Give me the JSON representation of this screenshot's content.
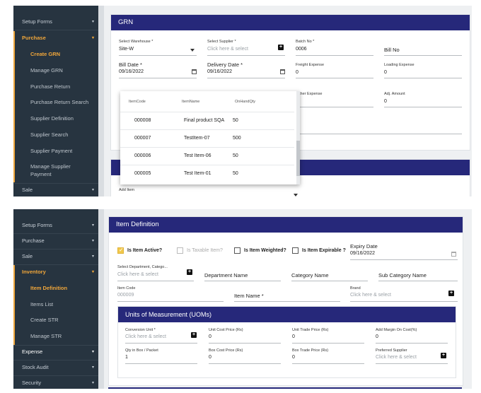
{
  "shot1": {
    "sidebar": {
      "setup_forms": "Setup Forms",
      "purchase": "Purchase",
      "items": [
        "Create GRN",
        "Manage GRN",
        "Purchase Return",
        "Purchase Return Search",
        "Supplier Definition",
        "Supplier Search",
        "Supplier Payment",
        "Manage Supplier Payment"
      ],
      "sale": "Sale"
    },
    "grn": {
      "title": "GRN",
      "warehouse_label": "Select Warehouse *",
      "warehouse_value": "Site-W",
      "supplier_label": "Select Supplier *",
      "supplier_placeholder": "Click here & select",
      "batch_label": "Batch No *",
      "batch_value": "0006",
      "bill_no_label": "Bill No",
      "bill_date_label": "Bill Date *",
      "bill_date_value": "09/16/2022",
      "delivery_date_label": "Delivery Date *",
      "delivery_date_value": "09/16/2022",
      "freight_label": "Freight Expense",
      "freight_value": "0",
      "loading_label": "Loading Expense",
      "loading_value": "0",
      "other_label": "ther Expense",
      "adj_label": "Adj. Amount",
      "adj_value": "0",
      "add_item_label": "Add Item"
    },
    "dropdown": {
      "headers": [
        "ItemCode",
        "ItemName",
        "OnHandQty"
      ],
      "rows": [
        {
          "code": "000008",
          "name": "Final product SQA",
          "qty": "50"
        },
        {
          "code": "000007",
          "name": "TestItem-07",
          "qty": "500"
        },
        {
          "code": "000006",
          "name": "Test Item-06",
          "qty": "50"
        },
        {
          "code": "000005",
          "name": "Test Item-01",
          "qty": "50"
        }
      ]
    }
  },
  "shot2": {
    "sidebar": {
      "setup_forms": "Setup Forms",
      "purchase": "Purchase",
      "sale": "Sale",
      "inventory": "Inventory",
      "items": [
        "Item Definition",
        "Items List",
        "Create STR",
        "Manage STR"
      ],
      "expense": "Expense",
      "stock_audit": "Stock Audit",
      "security": "Security"
    },
    "item_def": {
      "title": "Item Definition",
      "is_active": "Is Item Active?",
      "is_taxable": "Is Taxable Item?",
      "is_weighted": "Is Item Weighted?",
      "is_expirable": "Is Item Expirable ?",
      "expiry_label": "Expiry Date",
      "expiry_value": "09/16/2022",
      "dept_label": "Select Department, Catego...",
      "dept_placeholder": "Click here & select",
      "department_name": "Department Name",
      "category_name": "Category Name",
      "sub_category_name": "Sub Category Name",
      "item_code_label": "Item Code",
      "item_code_value": "000009",
      "item_name_label": "Item Name *",
      "brand_label": "Brand",
      "brand_placeholder": "Click here & select"
    },
    "uom": {
      "title": "Units of Measurement (UOMs)",
      "conversion_label": "Conversion Unit *",
      "conversion_placeholder": "Click here & select",
      "unit_cost_label": "Unit Cost Price (Rs)",
      "unit_cost_value": "0",
      "unit_trade_label": "Unit Trade Price (Rs)",
      "unit_trade_value": "0",
      "margin_label": "Add Margin On Cost(%)",
      "margin_value": "0",
      "qty_box_label": "Qty in Box / Packet",
      "qty_box_value": "1",
      "box_cost_label": "Box Cost Price (Rs)",
      "box_cost_value": "0",
      "box_trade_label": "Box Trade Price (Rs)",
      "box_trade_value": "0",
      "pref_supplier_label": "Preferred Supplier",
      "pref_supplier_placeholder": "Click here & select"
    }
  },
  "colors": {
    "sidebar": "#273440",
    "accent": "#f0a63a",
    "header": "#26287a"
  }
}
